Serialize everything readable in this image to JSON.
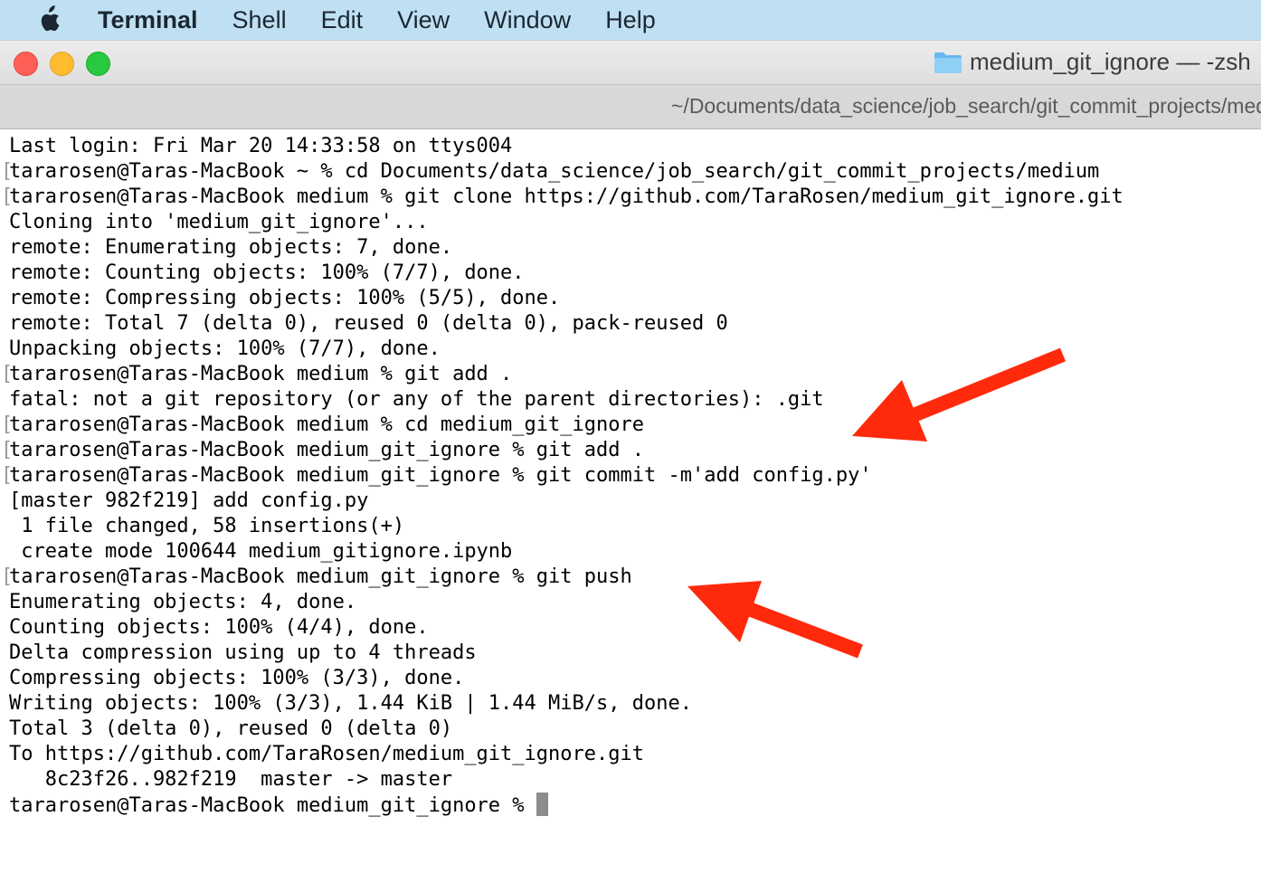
{
  "menubar": {
    "apple": "apple-icon",
    "app_name": "Terminal",
    "items": [
      "Shell",
      "Edit",
      "View",
      "Window",
      "Help"
    ]
  },
  "window": {
    "title": "medium_git_ignore — -zsh",
    "path": "~/Documents/data_science/job_search/git_commit_projects/medium/medium_git_ignore"
  },
  "terminal": {
    "lines": [
      "Last login: Fri Mar 20 14:33:58 on ttys004",
      "tararosen@Taras-MacBook ~ % cd Documents/data_science/job_search/git_commit_projects/medium",
      "tararosen@Taras-MacBook medium % git clone https://github.com/TaraRosen/medium_git_ignore.git",
      "Cloning into 'medium_git_ignore'...",
      "remote: Enumerating objects: 7, done.",
      "remote: Counting objects: 100% (7/7), done.",
      "remote: Compressing objects: 100% (5/5), done.",
      "remote: Total 7 (delta 0), reused 0 (delta 0), pack-reused 0",
      "Unpacking objects: 100% (7/7), done.",
      "tararosen@Taras-MacBook medium % git add .",
      "fatal: not a git repository (or any of the parent directories): .git",
      "tararosen@Taras-MacBook medium % cd medium_git_ignore",
      "tararosen@Taras-MacBook medium_git_ignore % git add .",
      "tararosen@Taras-MacBook medium_git_ignore % git commit -m'add config.py'",
      "[master 982f219] add config.py",
      " 1 file changed, 58 insertions(+)",
      " create mode 100644 medium_gitignore.ipynb",
      "tararosen@Taras-MacBook medium_git_ignore % git push",
      "Enumerating objects: 4, done.",
      "Counting objects: 100% (4/4), done.",
      "Delta compression using up to 4 threads",
      "Compressing objects: 100% (3/3), done.",
      "Writing objects: 100% (3/3), 1.44 KiB | 1.44 MiB/s, done.",
      "Total 3 (delta 0), reused 0 (delta 0)",
      "To https://github.com/TaraRosen/medium_git_ignore.git",
      "   8c23f26..982f219  master -> master",
      "tararosen@Taras-MacBook medium_git_ignore % "
    ]
  },
  "colors": {
    "menubar_bg": "#bfe0f2",
    "annotation_arrow": "#ff2a0c",
    "close": "#fe5f57",
    "minimize": "#febc2e",
    "maximize": "#28c840"
  }
}
